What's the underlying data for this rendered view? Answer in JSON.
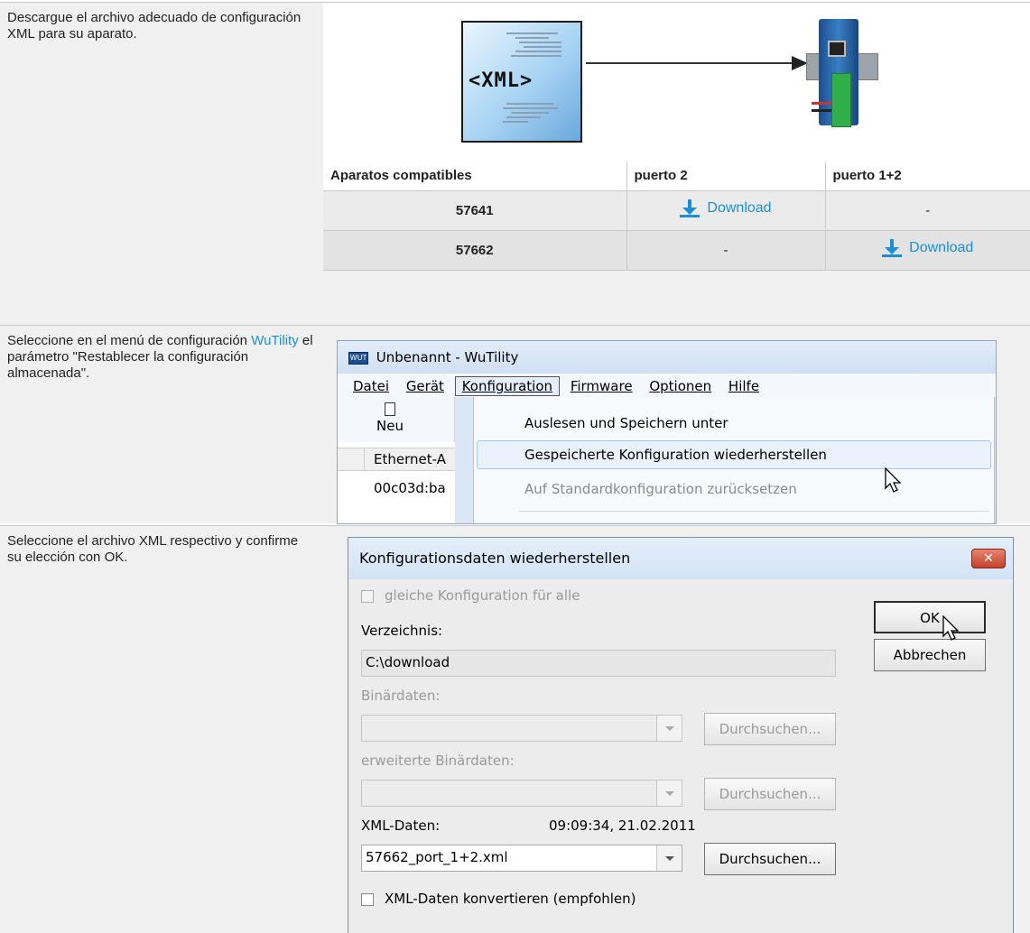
{
  "rows": [
    {
      "text": "Descargue el archivo adecuado de configuración XML para su aparato."
    },
    {
      "text_before": "Seleccione en el menú de configuración ",
      "link": "WuTility",
      "text_after": " el parámetro \"Restablecer la configuración almacenada\"."
    },
    {
      "text": "Seleccione el archivo XML respectivo y confirme su elección con OK."
    }
  ],
  "diagram": {
    "xml_tag": "<XML>"
  },
  "compat_table": {
    "headers": [
      "Aparatos compatibles",
      "puerto 2",
      "puerto 1+2"
    ],
    "rows": [
      {
        "model": "57641",
        "port2": "Download",
        "port12": "-"
      },
      {
        "model": "57662",
        "port2": "-",
        "port12": "Download"
      }
    ]
  },
  "wutility": {
    "app_badge": "WUT",
    "title": "Unbenannt - WuTility",
    "menu": [
      "Datei",
      "Gerät",
      "Konfiguration",
      "Firmware",
      "Optionen",
      "Hilfe"
    ],
    "active_menu": "Konfiguration",
    "toolbar_new": "Neu",
    "list_header": "Ethernet-A",
    "list_cell": "00c03d:ba",
    "dropdown_items": [
      "Auslesen und Speichern unter",
      "Gespeicherte Konfiguration wiederherstellen",
      "Auf Standardkonfiguration zurücksetzen"
    ]
  },
  "dialog": {
    "title": "Konfigurationsdaten wiederherstellen",
    "close_glyph": "✕",
    "same_config_label": "gleiche Konfiguration für alle",
    "directory_label": "Verzeichnis:",
    "directory_value": "C:\\download",
    "binary_label": "Binärdaten:",
    "browse_label": "Durchsuchen...",
    "ext_binary_label": "erweiterte Binärdaten:",
    "xml_label": "XML-Daten:",
    "xml_timestamp": "09:09:34, 21.02.2011",
    "xml_value": "57662_port_1+2.xml",
    "convert_label": "XML-Daten konvertieren (empfohlen)",
    "ok_label": "OK",
    "cancel_label": "Abbrechen"
  },
  "colors": {
    "link": "#1a8fd6",
    "row_bg": "#f0f0f0"
  }
}
